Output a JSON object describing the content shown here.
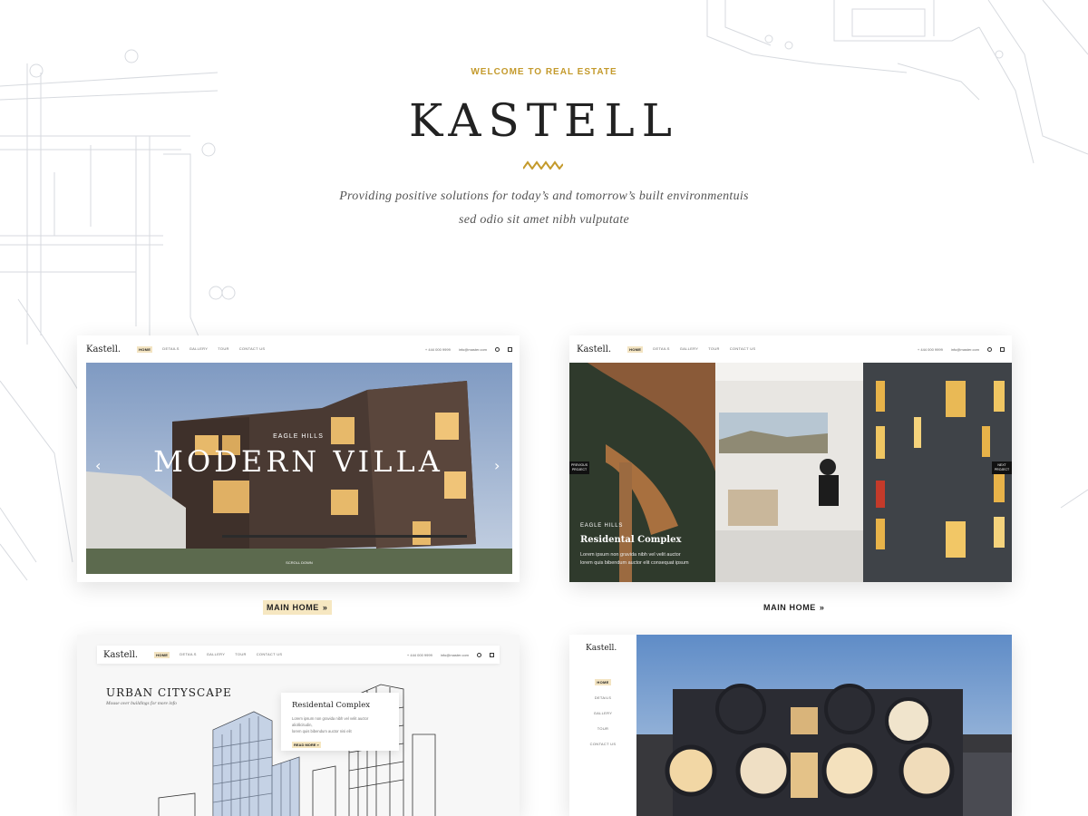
{
  "hero": {
    "eyebrow": "WELCOME TO REAL ESTATE",
    "title": "KASTELL",
    "tagline_line1": "Providing positive solutions for today’s and tomorrow’s built environmentuis",
    "tagline_line2": "sed odio sit amet nibh vulputate"
  },
  "colors": {
    "accent": "#c49a2c",
    "highlight": "#f6e7c1",
    "text": "#222222"
  },
  "nav": {
    "logo": "Kastell.",
    "links": [
      "HOME",
      "DETAILS",
      "GALLERY",
      "TOUR",
      "CONTACT US"
    ],
    "phone": "+ 444 000 9999",
    "email": "info@master.com"
  },
  "demo1": {
    "kicker": "EAGLE HILLS",
    "headline": "MODERN VILLA",
    "scroll": "SCROLL DOWN",
    "label": "MAIN HOME"
  },
  "demo2": {
    "prev": "PREVIOUS PROJECT",
    "next": "NEXT PROJECT",
    "kicker": "EAGLE HILLS",
    "headline": "Residental Complex",
    "desc1": "Lorem ipsum non gravida nibh vel velit auctor",
    "desc2": "lorem quis bibendum auctor elit consequat ipsum",
    "label": "MAIN HOME"
  },
  "demo3": {
    "headline": "URBAN CITYSCAPE",
    "subline": "Mouse over buildings for more info",
    "card_title": "Residental Complex",
    "card_text1": "Lorem ipsum non gravida nibh vel velit auctor aliollicitudin,",
    "card_text2": "lorem quis bibendum auctor nisi elit",
    "card_link": "READ MORE »"
  },
  "demo4": {
    "logo": "Kastell.",
    "links": [
      "HOME",
      "DETAILS",
      "GALLERY",
      "TOUR",
      "CONTACT US"
    ]
  }
}
